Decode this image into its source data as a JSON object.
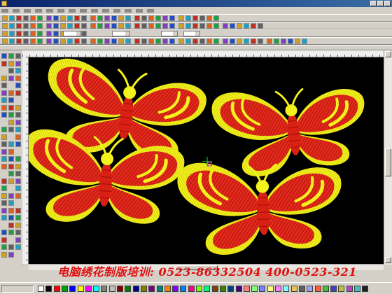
{
  "window": {
    "title": ""
  },
  "menubar": {
    "items": [
      "",
      "",
      "",
      "",
      "",
      "",
      "",
      "",
      "",
      "",
      "",
      "",
      "",
      ""
    ]
  },
  "watermark": {
    "text": "电脑绣花制版培训: 0523-86332504  400-0523-321"
  },
  "design": {
    "motif": "butterfly",
    "count": 4,
    "colors": {
      "body": "#e52a1c",
      "wings": "#e52a1c",
      "outline": "#f2f21c",
      "background": "#000000"
    }
  },
  "palette": [
    "#ffffff",
    "#000000",
    "#ff0000",
    "#00a000",
    "#0000ff",
    "#ffff00",
    "#ff00ff",
    "#00ffff",
    "#808080",
    "#c0c0c0",
    "#800000",
    "#008000",
    "#000080",
    "#808000",
    "#800080",
    "#008080",
    "#ff8000",
    "#8000ff",
    "#0080ff",
    "#ff0080",
    "#80ff00",
    "#00ff80",
    "#804000",
    "#408000",
    "#004080",
    "#400080",
    "#ff8080",
    "#80ff80",
    "#8080ff",
    "#ffff80",
    "#ff80ff",
    "#80ffff",
    "#e8c060",
    "#606060",
    "#a0a0ff",
    "#ff6040",
    "#40c040",
    "#4040c0",
    "#c0c040",
    "#c040c0",
    "#40c0c0",
    "#202020"
  ]
}
